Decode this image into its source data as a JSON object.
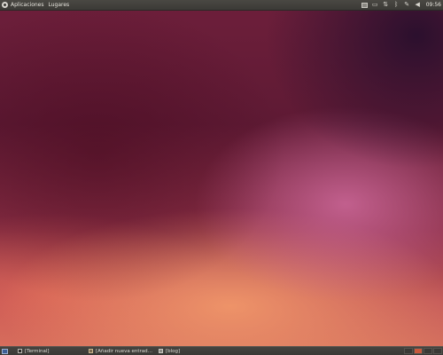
{
  "top_panel": {
    "menus": [
      {
        "label": "Aplicaciones"
      },
      {
        "label": "Lugares"
      }
    ],
    "clock": "09:56",
    "tray_icons": [
      "keyboard-layout-icon",
      "display-icon",
      "network-icon",
      "bluetooth-icon",
      "pen-icon",
      "volume-icon"
    ]
  },
  "taskbar": {
    "tasks": [
      {
        "label": "[Terminal]",
        "icon": "terminal-icon"
      },
      {
        "label": "[Añadir nueva entrad…",
        "icon": "editor-icon"
      },
      {
        "label": "[blog]",
        "icon": "folder-icon"
      }
    ],
    "workspaces": [
      {
        "active": false
      },
      {
        "active": true
      },
      {
        "active": false
      },
      {
        "active": false
      }
    ]
  },
  "colors": {
    "panel_bg": "#3b3a36",
    "active_workspace": "#c8583c",
    "inactive_workspace": "#3a3935"
  }
}
